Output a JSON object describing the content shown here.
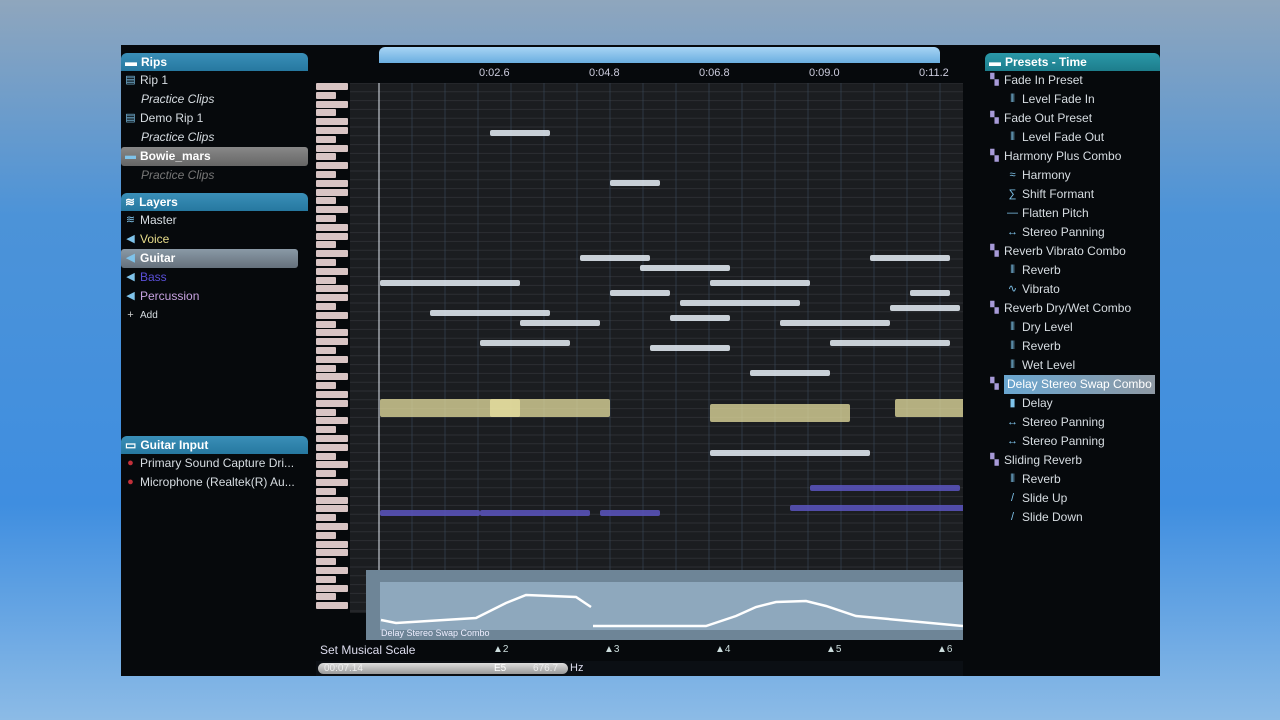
{
  "rips": {
    "title": "Rips",
    "items": [
      {
        "label": "Rip 1",
        "icon": "document-icon",
        "type": "file"
      },
      {
        "label": "Practice Clips",
        "type": "sub"
      },
      {
        "label": "Demo Rip 1",
        "icon": "document-icon",
        "type": "file"
      },
      {
        "label": "Practice Clips",
        "type": "sub"
      },
      {
        "label": "Bowie_mars",
        "icon": "folder-icon",
        "type": "file",
        "selected": true
      },
      {
        "label": "Practice Clips",
        "type": "sub"
      }
    ]
  },
  "layers": {
    "title": "Layers",
    "items": [
      {
        "label": "Master",
        "icon": "stack-icon",
        "color": "#d7dde2"
      },
      {
        "label": "Voice",
        "icon": "speaker-icon",
        "color": "#e7dc8a"
      },
      {
        "label": "Guitar",
        "icon": "speaker-icon",
        "color": "#ffffff",
        "selected": true
      },
      {
        "label": "Bass",
        "icon": "speaker-icon",
        "color": "#5a4fd8"
      },
      {
        "label": "Percussion",
        "icon": "speaker-icon",
        "color": "#c7a2e0"
      }
    ],
    "add_label": "Add"
  },
  "input": {
    "title": "Guitar Input",
    "items": [
      "Primary Sound Capture Dri...",
      "Microphone (Realtek(R) Au..."
    ]
  },
  "timeline": {
    "ticks": [
      "0:02.6",
      "0:04.8",
      "0:06.8",
      "0:09.0",
      "0:11.2"
    ]
  },
  "automation": {
    "label": "Delay Stereo Swap Combo",
    "markers": [
      "2",
      "3",
      "4",
      "5",
      "6"
    ]
  },
  "status": {
    "label": "Set Musical Scale",
    "left_value": "00:07.14",
    "note": "E5",
    "freq": "676.7",
    "unit": "Hz"
  },
  "presets": {
    "title": "Presets - Time",
    "groups": [
      {
        "label": "Fade In Preset",
        "children": [
          {
            "label": "Level Fade In",
            "icon": "level-icon"
          }
        ]
      },
      {
        "label": "Fade Out Preset",
        "children": [
          {
            "label": "Level Fade Out",
            "icon": "level-icon"
          }
        ]
      },
      {
        "label": "Harmony Plus Combo",
        "children": [
          {
            "label": "Harmony",
            "icon": "harmony-icon"
          },
          {
            "label": "Shift Formant",
            "icon": "formant-icon"
          },
          {
            "label": "Flatten Pitch",
            "icon": "flat-icon"
          },
          {
            "label": "Stereo Panning",
            "icon": "pan-icon"
          }
        ]
      },
      {
        "label": "Reverb Vibrato Combo",
        "children": [
          {
            "label": "Reverb",
            "icon": "reverb-icon"
          },
          {
            "label": "Vibrato",
            "icon": "vibrato-icon"
          }
        ]
      },
      {
        "label": "Reverb Dry/Wet Combo",
        "children": [
          {
            "label": "Dry Level",
            "icon": "level-icon"
          },
          {
            "label": "Reverb",
            "icon": "reverb-icon"
          },
          {
            "label": "Wet Level",
            "icon": "level-icon"
          }
        ]
      },
      {
        "label": "Delay Stereo Swap Combo",
        "selected": true,
        "children": [
          {
            "label": "Delay",
            "icon": "delay-icon"
          },
          {
            "label": "Stereo Panning",
            "icon": "pan-icon"
          },
          {
            "label": "Stereo Panning",
            "icon": "pan-icon"
          }
        ]
      },
      {
        "label": "Sliding Reverb",
        "children": [
          {
            "label": "Reverb",
            "icon": "reverb-icon"
          },
          {
            "label": "Slide Up",
            "icon": "slide-icon"
          },
          {
            "label": "Slide Down",
            "icon": "slide-icon"
          }
        ]
      }
    ]
  }
}
